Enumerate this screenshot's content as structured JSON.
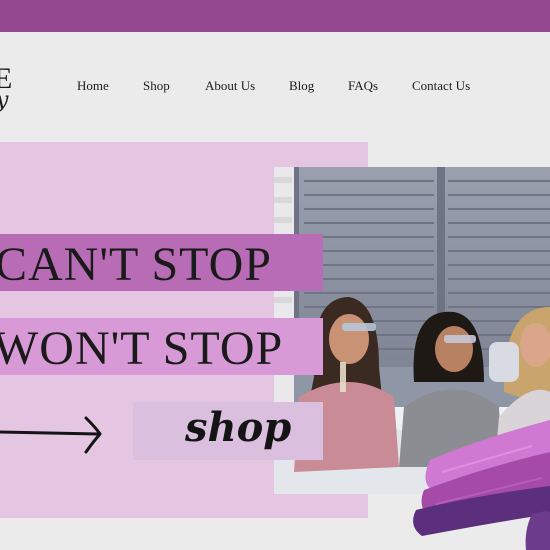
{
  "brand": {
    "logo_main": "E",
    "logo_script": "y"
  },
  "nav": {
    "items": [
      {
        "label": "Home"
      },
      {
        "label": "Shop"
      },
      {
        "label": "About Us"
      },
      {
        "label": "Blog"
      },
      {
        "label": "FAQs"
      },
      {
        "label": "Contact Us"
      }
    ]
  },
  "hero": {
    "line1": "CAN'T STOP",
    "line2": "WON'T STOP",
    "cta_label": "shop"
  },
  "colors": {
    "top_bar": "#93488f",
    "header_bg": "#ebebeb",
    "hero_bg": "#e5c6e2",
    "headline1_bg": "#b96cb6",
    "headline2_bg": "#d79ad7",
    "shop_bg": "#dbbfdf"
  },
  "icons": [
    "arrow-right-icon",
    "brush-stroke-decoration"
  ]
}
